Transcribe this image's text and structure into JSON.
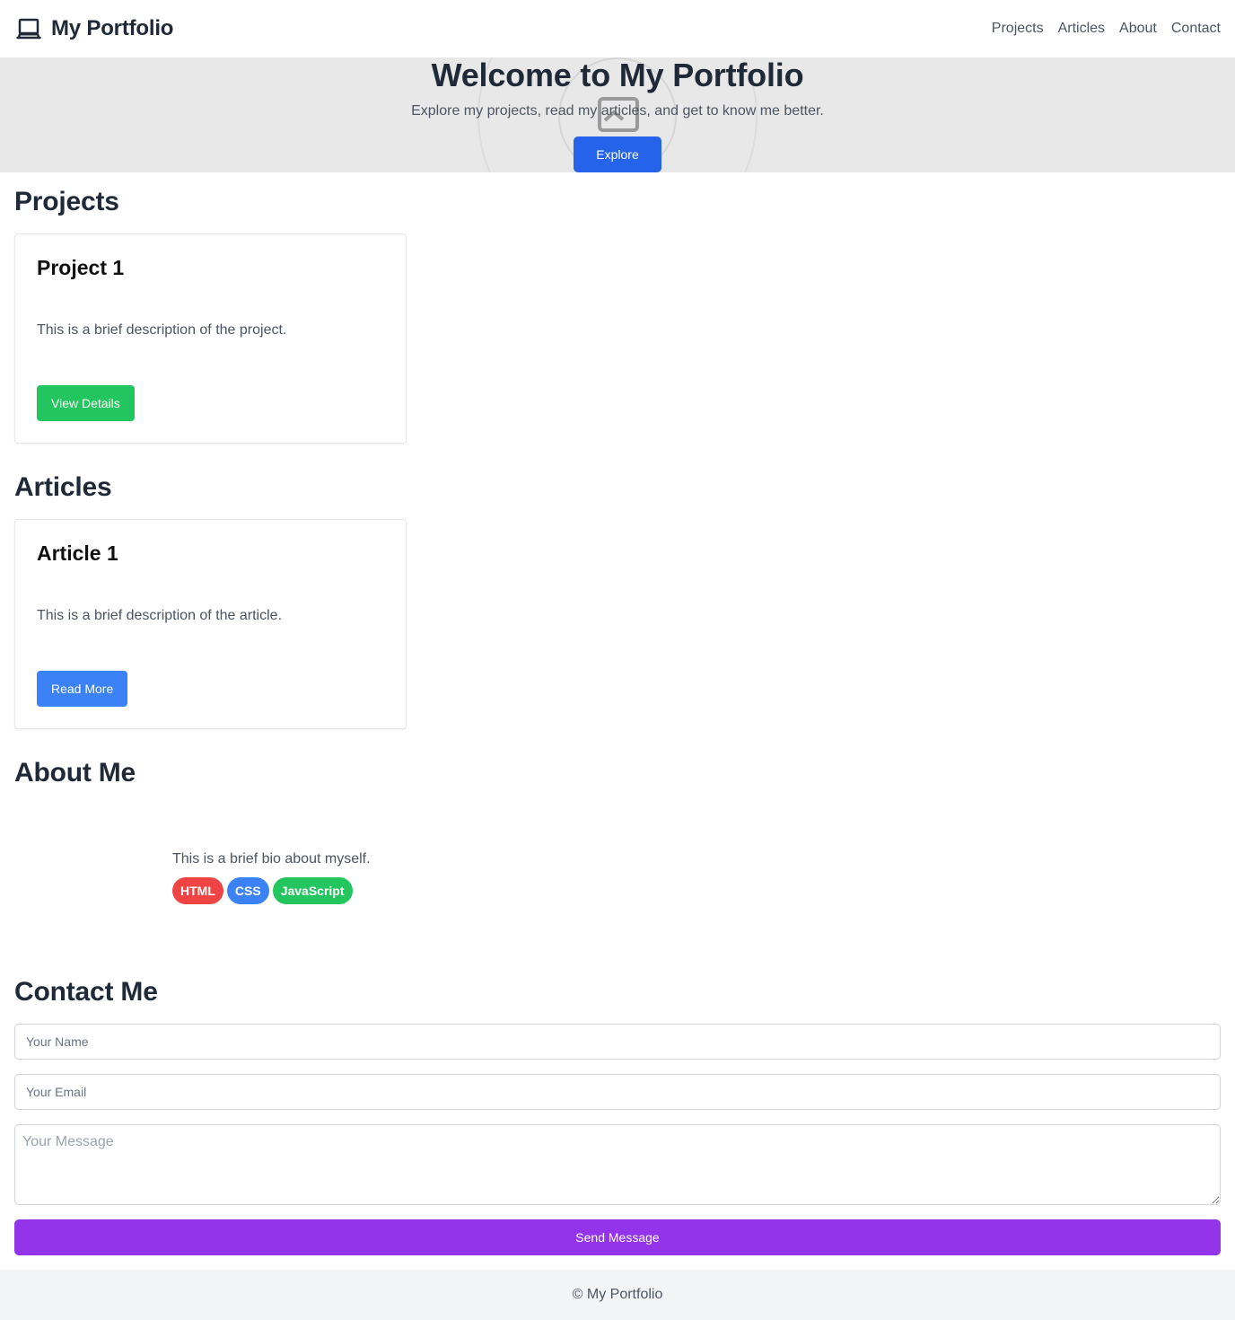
{
  "header": {
    "brand": "My Portfolio",
    "brand_icon": "laptop-icon",
    "nav": [
      "Projects",
      "Articles",
      "About",
      "Contact"
    ]
  },
  "hero": {
    "title": "Welcome to My Portfolio",
    "subtitle": "Explore my projects, read my articles, and get to know me better.",
    "button": "Explore",
    "background_icon": "image-placeholder-icon"
  },
  "projects": {
    "heading": "Projects",
    "items": [
      {
        "title": "Project 1",
        "description": "This is a brief description of the project.",
        "button": "View Details"
      }
    ]
  },
  "articles": {
    "heading": "Articles",
    "items": [
      {
        "title": "Article 1",
        "description": "This is a brief description of the article.",
        "button": "Read More"
      }
    ]
  },
  "about": {
    "heading": "About Me",
    "bio": "This is a brief bio about myself.",
    "skills": [
      {
        "label": "HTML",
        "color": "#ef4444"
      },
      {
        "label": "CSS",
        "color": "#3b82f6"
      },
      {
        "label": "JavaScript",
        "color": "#22c55e"
      }
    ]
  },
  "contact": {
    "heading": "Contact Me",
    "name_placeholder": "Your Name",
    "email_placeholder": "Your Email",
    "message_placeholder": "Your Message",
    "submit": "Send Message"
  },
  "footer": {
    "text": "© My Portfolio"
  },
  "colors": {
    "primary_blue": "#2563eb",
    "green": "#22c55e",
    "purple": "#9333ea",
    "hero_bg": "#e8e8e8"
  }
}
